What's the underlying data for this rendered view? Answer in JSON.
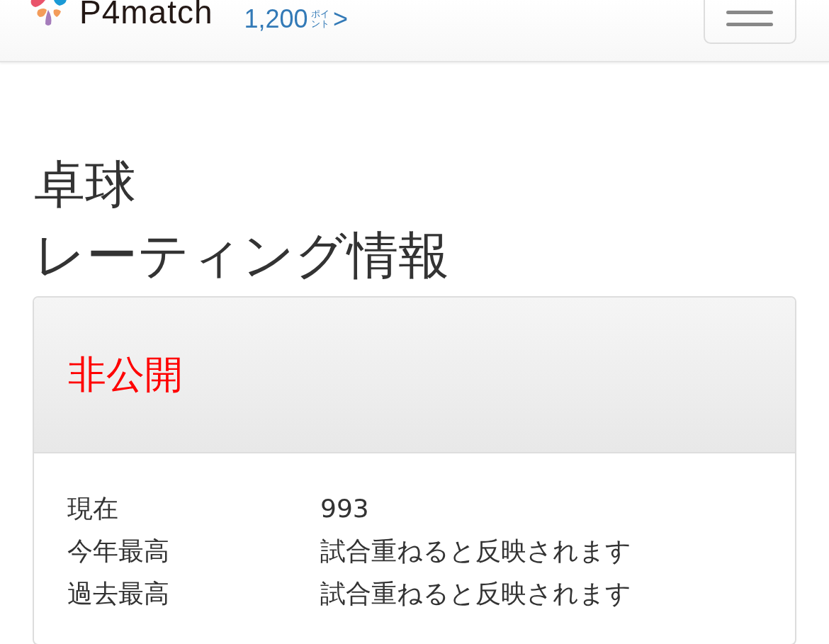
{
  "header": {
    "logo_text": "P4match",
    "points": {
      "value": "1,200",
      "unit": "ポイント",
      "arrow": ">"
    }
  },
  "title_lines": [
    "卓球",
    "レーティング情報"
  ],
  "panel": {
    "status": "非公開",
    "rows": [
      {
        "label": "現在",
        "value": "993"
      },
      {
        "label": "今年最高",
        "value": "試合重ねると反映されます"
      },
      {
        "label": "過去最高",
        "value": "試合重ねると反映されます"
      }
    ]
  }
}
